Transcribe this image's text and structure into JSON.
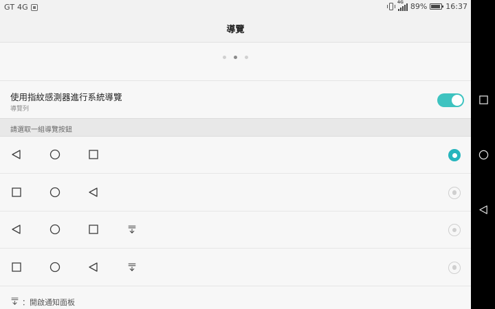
{
  "status_bar": {
    "carrier": "GT 4G",
    "network_badge": "4G",
    "battery": "89%",
    "battery_level": 0.89,
    "time": "16:37",
    "icons": [
      "sim-icon",
      "vibrate-icon",
      "signal-icon",
      "battery-icon"
    ]
  },
  "header": {
    "title": "導覽"
  },
  "pager": {
    "count": 3,
    "active_index": 1
  },
  "fingerprint_setting": {
    "title": "使用指紋感測器進行系統導覽",
    "subtitle": "導覽列",
    "enabled": true
  },
  "section": {
    "title": "請選取一組導覽按鈕"
  },
  "options": [
    {
      "buttons": [
        "back-icon",
        "home-icon",
        "recents-icon"
      ],
      "selected": true
    },
    {
      "buttons": [
        "recents-icon",
        "home-icon",
        "back-icon"
      ],
      "selected": false
    },
    {
      "buttons": [
        "back-icon",
        "home-icon",
        "recents-icon",
        "notification-icon"
      ],
      "selected": false
    },
    {
      "buttons": [
        "recents-icon",
        "home-icon",
        "back-icon",
        "notification-icon"
      ],
      "selected": false
    }
  ],
  "legend": {
    "icon": "notification-icon",
    "text": "：開啟通知面板"
  },
  "system_nav": [
    "recents-icon",
    "home-icon",
    "back-icon"
  ],
  "colors": {
    "accent": "#26b5bd",
    "toggle": "#3ec3c0"
  }
}
